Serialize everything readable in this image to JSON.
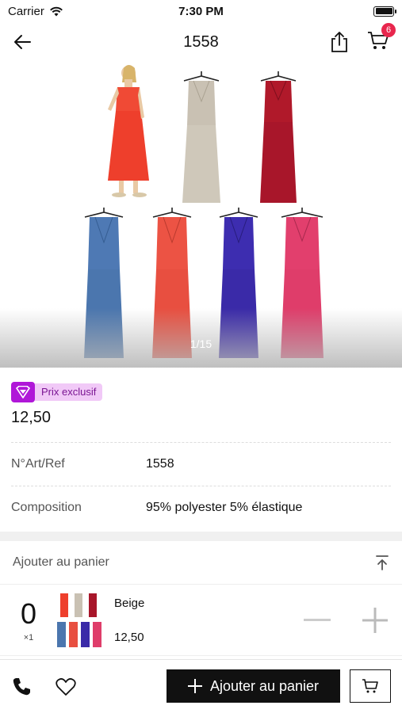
{
  "status_bar": {
    "carrier": "Carrier",
    "time": "7:30 PM",
    "battery_level": 1.0
  },
  "nav": {
    "title": "1558",
    "cart_count": "6"
  },
  "gallery": {
    "counter": "1/15"
  },
  "product": {
    "exclusive_label": "Prix exclusif",
    "price": "12,50",
    "attributes": [
      {
        "label": "N°Art/Ref",
        "value": "1558"
      },
      {
        "label": "Composition",
        "value": "95% polyester 5% élastique"
      }
    ]
  },
  "cart_section": {
    "header": "Ajouter au panier",
    "variants": [
      {
        "quantity": "0",
        "multiplier": "×1",
        "color": "Beige",
        "price": "12,50"
      }
    ]
  },
  "bottom_bar": {
    "add_button_label": "Ajouter au panier"
  },
  "colors": {
    "accent": "#e8264d",
    "exclusive": "#b017d8",
    "button": "#111111"
  }
}
